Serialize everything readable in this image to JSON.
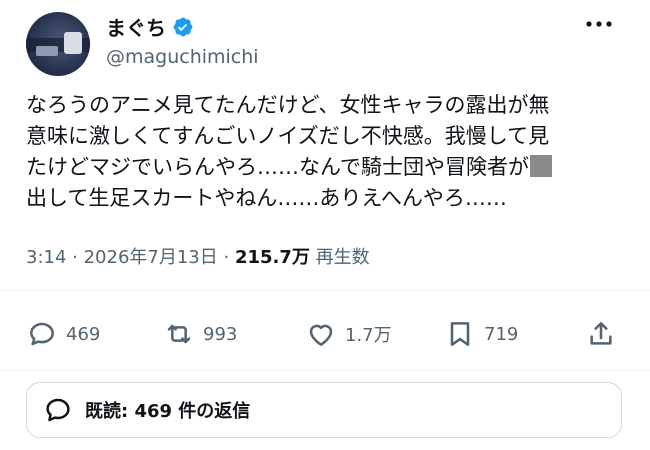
{
  "author": {
    "name": "まぐち",
    "handle": "@maguchimichi",
    "verified": true
  },
  "tweet": {
    "text_line1": "なろうのアニメ見てたんだけど、女性キャラの露出が無",
    "text_line2": "意味に激しくてすんごいノイズだし不快感。我慢して見",
    "text_line3": "たけどマジでいらんやろ……なんで騎士団や冒険者が",
    "text_line4": "出して生足スカートやねん……ありえへんやろ……"
  },
  "meta": {
    "time": "3:14",
    "separator": " · ",
    "date": "2026年7月13日",
    "views_count": "215.7万",
    "views_label": "再生数"
  },
  "actions": {
    "replies": "469",
    "reposts": "993",
    "likes": "1.7万",
    "bookmarks": "719"
  },
  "read_replies": {
    "label": "既読: 469 件の返信"
  },
  "colors": {
    "verified": "#1d9bf0",
    "text": "#0f1419",
    "secondary": "#536471",
    "border": "#cfd9de"
  }
}
